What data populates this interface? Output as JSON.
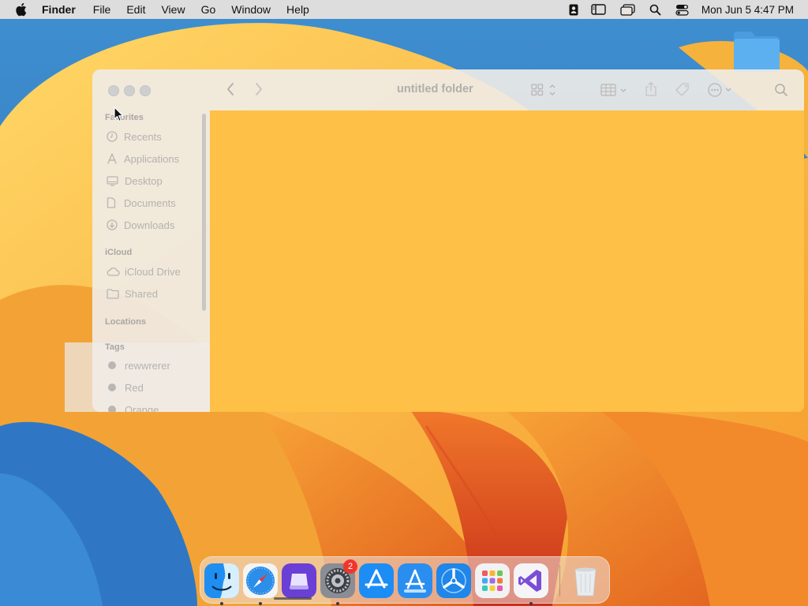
{
  "menubar": {
    "app_name": "Finder",
    "items": [
      "File",
      "Edit",
      "View",
      "Go",
      "Window",
      "Help"
    ],
    "status_icons": [
      "contacts-card-icon",
      "sidebar-toggle-icon",
      "windows-icon",
      "spotlight-search-icon",
      "control-center-icon"
    ],
    "clock": "Mon Jun 5  4:47 PM"
  },
  "finder": {
    "title": "untitled folder",
    "sidebar": {
      "favorites_heading": "Favorites",
      "favorites": [
        "Recents",
        "Applications",
        "Desktop",
        "Documents",
        "Downloads"
      ],
      "icloud_heading": "iCloud",
      "icloud": [
        "iCloud Drive",
        "Shared"
      ],
      "locations_heading": "Locations",
      "tags_heading": "Tags",
      "tags": [
        "rewwrerer",
        "Red",
        "Orange"
      ]
    }
  },
  "dock": {
    "apps": [
      "Finder",
      "Safari",
      "Apple Configurator",
      "System Settings",
      "App Store",
      "Xcode Instruments",
      "TestFlight",
      "Launchpad",
      "Visual Studio"
    ],
    "settings_badge": "2"
  },
  "colors": {
    "drop_highlight": "#fec046",
    "menubar": "#ece4de"
  }
}
